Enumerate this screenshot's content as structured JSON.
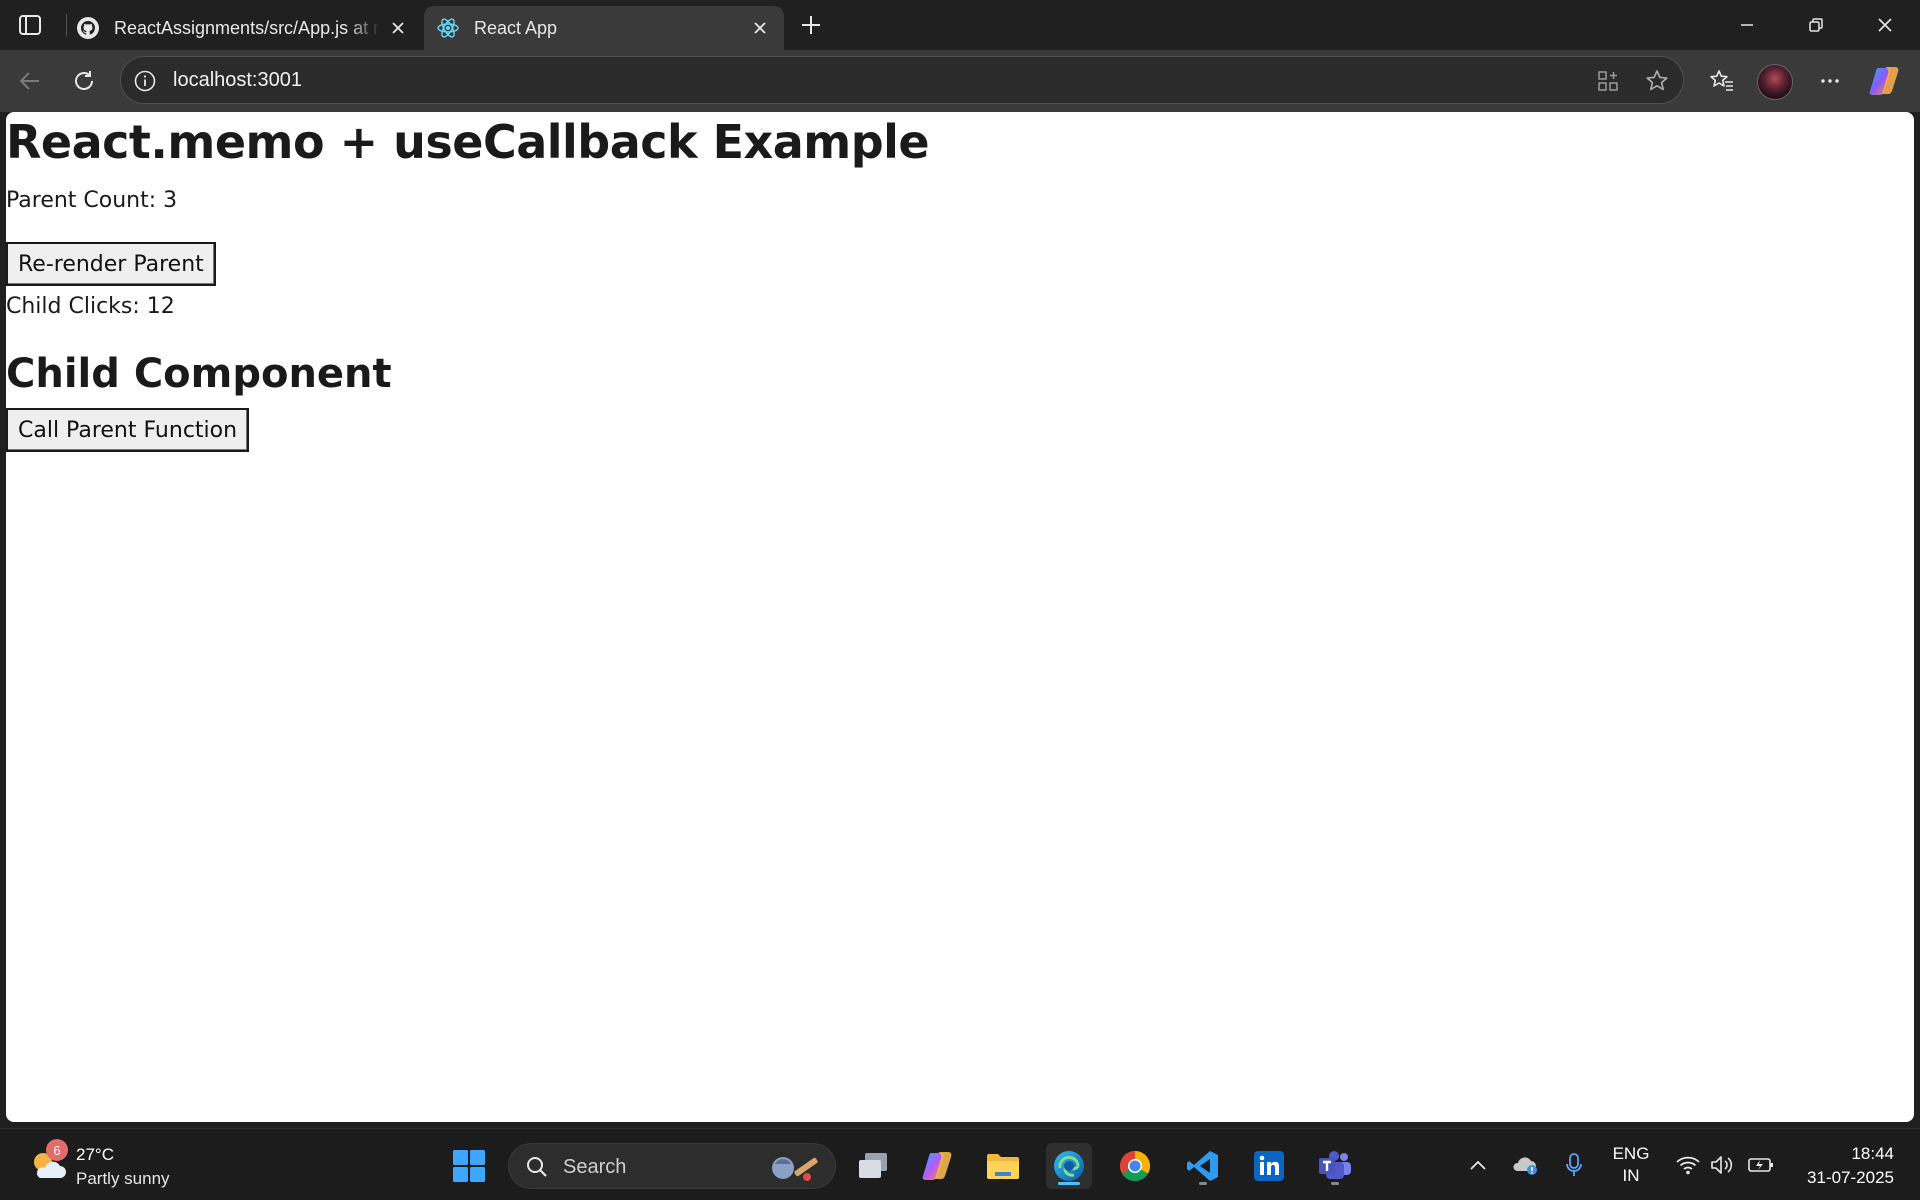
{
  "browser": {
    "tabs": [
      {
        "title": "ReactAssignments/src/App.js at m",
        "favicon": "github-icon",
        "active": false
      },
      {
        "title": "React App",
        "favicon": "react-icon",
        "active": true
      }
    ],
    "address": {
      "url": "localhost:3001"
    }
  },
  "page": {
    "heading": "React.memo + useCallback Example",
    "parent_count_text": "Parent Count: 3",
    "rerender_button": "Re-render Parent",
    "child_clicks_text": "Child Clicks: 12",
    "child_heading": "Child Component",
    "call_parent_button": "Call Parent Function"
  },
  "taskbar": {
    "weather": {
      "temp": "27°C",
      "condition": "Partly sunny",
      "badge": "6"
    },
    "search_label": "Search",
    "language": {
      "line1": "ENG",
      "line2": "IN"
    },
    "clock": {
      "time": "18:44",
      "date": "31-07-2025"
    }
  },
  "colors": {
    "chrome_dark": "#202020",
    "toolbar": "#3a3a3a",
    "edge_accent": "#4cc2ff"
  }
}
